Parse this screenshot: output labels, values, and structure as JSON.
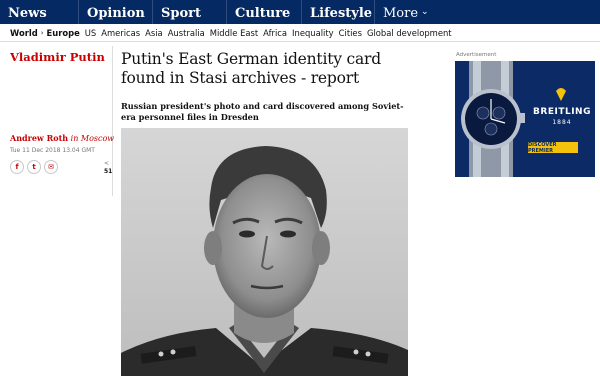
{
  "nav": {
    "pillars": [
      {
        "label": "News"
      },
      {
        "label": "Opinion"
      },
      {
        "label": "Sport"
      },
      {
        "label": "Culture"
      },
      {
        "label": "Lifestyle"
      },
      {
        "label": "More"
      }
    ],
    "more_icon": "chevron-down-icon"
  },
  "subnav": {
    "world": "World",
    "current": "Europe",
    "links": [
      "US",
      "Americas",
      "Asia",
      "Australia",
      "Middle East",
      "Africa",
      "Inequality",
      "Cities",
      "Global development"
    ]
  },
  "section": {
    "title": "Vladimir Putin"
  },
  "byline": {
    "author": "Andrew Roth",
    "location": "in Moscow"
  },
  "dateline": "Tue 11 Dec 2018 13.04 GMT",
  "share": {
    "icons": [
      "facebook-icon",
      "twitter-icon",
      "email-icon"
    ],
    "glyphs": [
      "f",
      "t",
      "✉"
    ],
    "count_arrow": "<",
    "count": "51"
  },
  "article": {
    "headline": "Putin's East German identity card found in Stasi archives - report",
    "standfirst": "Russian president's photo and card discovered among Soviet-era personnel files in Dresden"
  },
  "ad": {
    "label": "Advertisement",
    "brand": "BREITLING",
    "year": "1884",
    "cta": "DISCOVER PREMIER"
  },
  "colors": {
    "nav_background": "#052962",
    "accent_red": "#c70000",
    "ad_background": "#0c2b66",
    "ad_cta": "#f4c20d"
  }
}
